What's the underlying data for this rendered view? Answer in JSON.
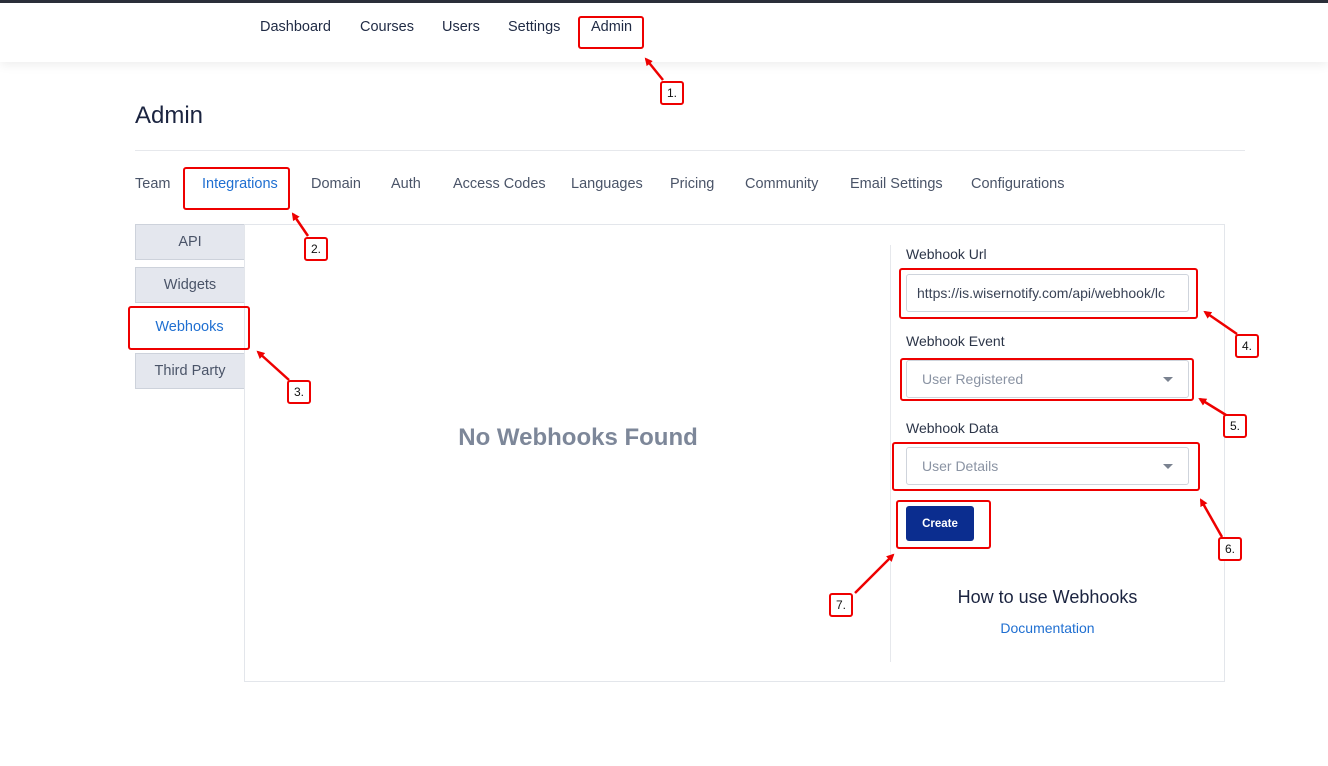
{
  "topnav": {
    "items": [
      "Dashboard",
      "Courses",
      "Users",
      "Settings",
      "Admin"
    ],
    "active": "Admin"
  },
  "page": {
    "title": "Admin"
  },
  "admin_tabs": {
    "items": [
      "Team",
      "Integrations",
      "Domain",
      "Auth",
      "Access Codes",
      "Languages",
      "Pricing",
      "Community",
      "Email Settings",
      "Configurations"
    ],
    "active": "Integrations"
  },
  "sidebar": {
    "items": [
      "API",
      "Widgets",
      "Webhooks",
      "Third Party"
    ],
    "active": "Webhooks"
  },
  "main": {
    "empty_message": "No Webhooks Found"
  },
  "form": {
    "url_label": "Webhook Url",
    "url_value": "https://is.wisernotify.com/api/webhook/lc",
    "event_label": "Webhook Event",
    "event_value": "User Registered",
    "data_label": "Webhook Data",
    "data_value": "User Details",
    "create_label": "Create"
  },
  "help": {
    "title": "How to use Webhooks",
    "link": "Documentation"
  },
  "annotations": [
    "1.",
    "2.",
    "3.",
    "4.",
    "5.",
    "6.",
    "7."
  ],
  "colors": {
    "accent": "#1f6fd1",
    "primary_button": "#0b2d8f",
    "annotation": "#ee0000",
    "topbar": "#2b2f3a"
  },
  "icons": {
    "select_caret": "caret-down-icon",
    "annotation_arrow": "arrow-icon"
  }
}
